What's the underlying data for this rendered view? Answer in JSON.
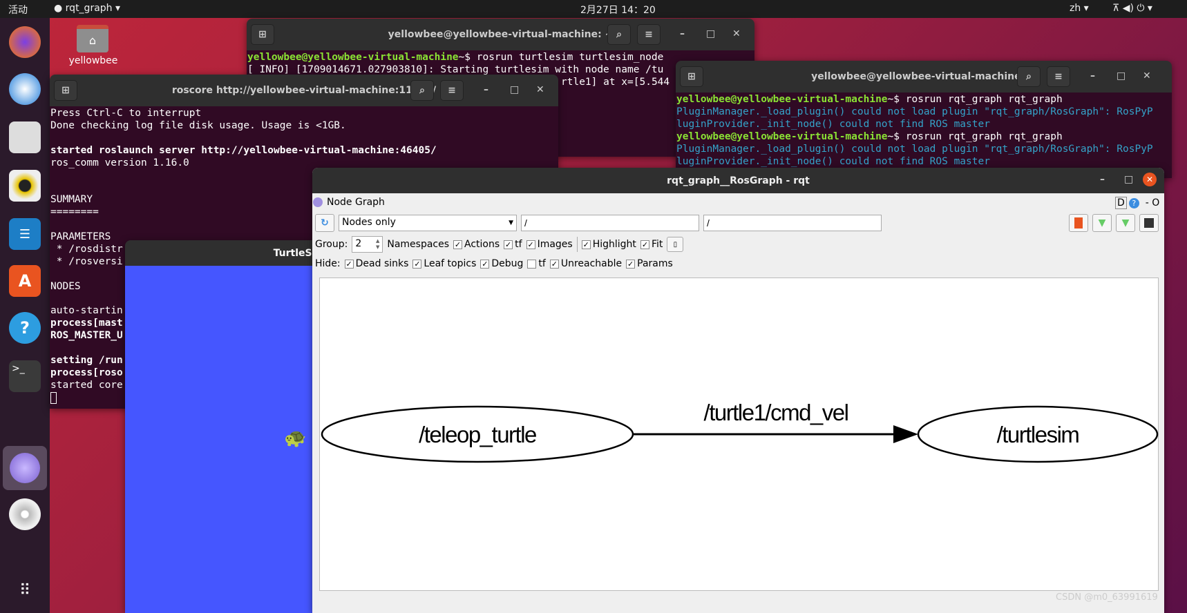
{
  "topbar": {
    "activities": "活动",
    "app": "rqt_graph ▾",
    "clock": "2月27日  14：20",
    "lang": "zh ▾",
    "status_icons": "network-icon volume-icon power-icon"
  },
  "desktop": {
    "home_label": "yellowbee"
  },
  "dock": {
    "items": [
      "firefox",
      "thunderbird",
      "files",
      "rhythmbox",
      "libreoffice-writer",
      "software",
      "help",
      "terminal",
      "rqt",
      "dvd",
      "show-apps"
    ]
  },
  "term1": {
    "title": "yellowbee@yellowbee-virtual-machine: ~",
    "lines": [
      {
        "prompt": "yellowbee@yellowbee-virtual-machine",
        "cmd": "~$ rosrun turtlesim turtlesim_node"
      },
      {
        "text": "[ INFO] [1709014671.027903810]: Starting turtlesim with node name /tu"
      },
      {
        "text": "                                          rtle1] at x=[5.544"
      }
    ]
  },
  "term2": {
    "title": "roscore http://yellowbee-virtual-machine:11311/",
    "lines": [
      "Press Ctrl-C to interrupt",
      "Done checking log file disk usage. Usage is <1GB.",
      "",
      "started roslaunch server http://yellowbee-virtual-machine:46405/",
      "ros_comm version 1.16.0",
      "",
      "",
      "SUMMARY",
      "========",
      "",
      "PARAMETERS",
      " * /rosdistr",
      " * /rosversi",
      "",
      "NODES",
      "",
      "auto-startin",
      "process[mast",
      "ROS_MASTER_U",
      "",
      "setting /run",
      "process[roso",
      "started core"
    ]
  },
  "term3": {
    "title": "yellowbee@yellowbee-virtual-machine: ~",
    "prompt": "yellowbee@yellowbee-virtual-machine",
    "cmd": "~$ rosrun rqt_graph rqt_graph",
    "err1": "PluginManager._load_plugin() could not load plugin \"rqt_graph/RosGraph\": RosPyP",
    "err2": "luginProvider._init_node() could not find ROS master"
  },
  "turtlesim": {
    "title": "TurtleSim",
    "bg": "#4556ff"
  },
  "rqt": {
    "title": "rqt_graph__RosGraph - rqt",
    "plugin": "Node Graph",
    "right_tools": "D",
    "dash": "- O",
    "mode": "Nodes only",
    "filter1": "/",
    "filter2": "/",
    "group_label": "Group:",
    "group_value": "2",
    "row2": [
      {
        "label": "Namespaces",
        "checked": null
      },
      {
        "label": "Actions",
        "checked": true
      },
      {
        "label": "tf",
        "checked": true
      },
      {
        "label": "Images",
        "checked": true
      },
      {
        "label": "Highlight",
        "checked": true
      },
      {
        "label": "Fit",
        "checked": true
      }
    ],
    "hide_label": "Hide:",
    "hide": [
      {
        "label": "Dead sinks",
        "checked": true
      },
      {
        "label": "Leaf topics",
        "checked": true
      },
      {
        "label": "Debug",
        "checked": true
      },
      {
        "label": "tf",
        "checked": false
      },
      {
        "label": "Unreachable",
        "checked": true
      },
      {
        "label": "Params",
        "checked": true
      }
    ],
    "graph": {
      "nodes": [
        "/teleop_turtle",
        "/turtlesim"
      ],
      "edge": "/turtle1/cmd_vel"
    }
  },
  "watermark": "CSDN @m0_63991619"
}
